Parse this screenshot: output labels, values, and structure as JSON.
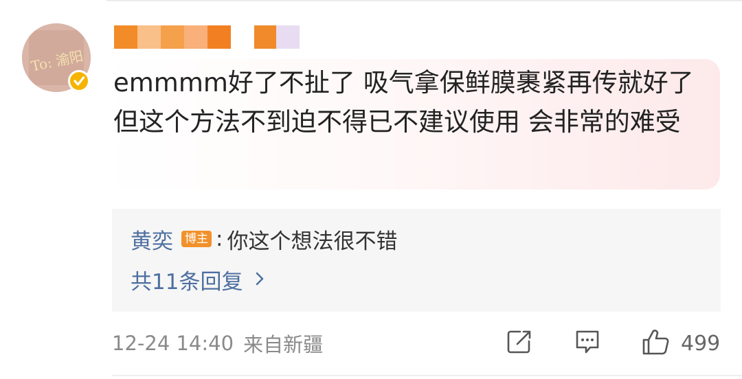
{
  "comment": {
    "avatar_text": "To: 渝阳",
    "text": "emmmm好了不扯了 吸气拿保鲜膜裹紧再传就好了 但这个方法不到迫不得已不建议使用 会非常的难受",
    "username_blur_colors": [
      "#f28c28",
      "#f9c08a",
      "#f5a04a",
      "#f9b07a",
      "#f28022",
      "#ffffff",
      "#f08a2a",
      "#e8dcf2"
    ]
  },
  "reply": {
    "author": "黄奕",
    "badge": "博主",
    "separator": ":",
    "text": "你这个想法很不错",
    "more": "共11条回复"
  },
  "meta": {
    "time": "12-24 14:40",
    "location": "来自新疆"
  },
  "actions": {
    "like_count": "499"
  },
  "colors": {
    "link": "#4d6fa0",
    "badge": "#f2912a",
    "verified": "#f5b400"
  },
  "icons": [
    "verified-icon",
    "chevron-right-icon",
    "share-icon",
    "comment-icon",
    "like-icon"
  ]
}
